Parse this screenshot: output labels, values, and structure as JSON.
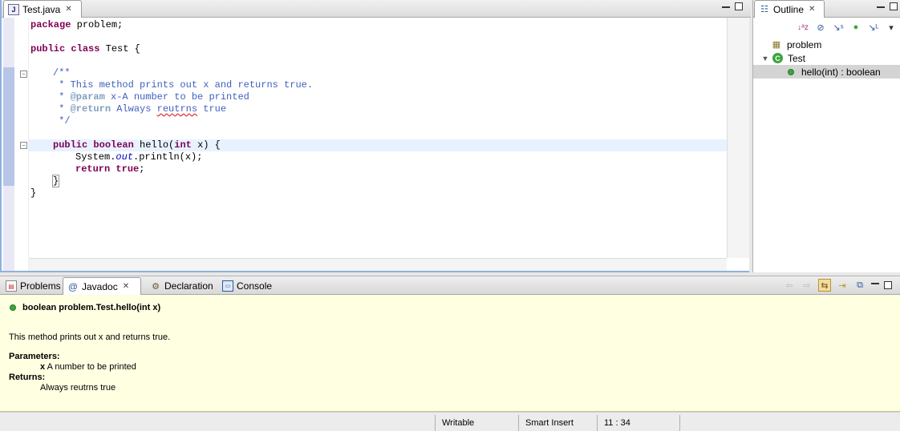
{
  "editor": {
    "tab_label": "Test.java",
    "code_lines": [
      [
        "package problem;"
      ],
      [],
      [
        "public class Test {"
      ],
      [],
      [
        "/**"
      ],
      [
        " * This method prints out x and returns true."
      ],
      [
        " * @param x-A number to be printed"
      ],
      [
        " * @return Always reutrns true"
      ],
      [
        " */"
      ],
      [],
      [
        "public boolean hello(int x) {"
      ],
      [
        "System.out.println(x);"
      ],
      [
        "return true;"
      ],
      [
        "}"
      ],
      [
        "}"
      ]
    ],
    "segments": {
      "l1_kw": "package",
      "l1_rest": " problem;",
      "l3_kw1": "public",
      "l3_kw2": "class",
      "l3_rest": " Test {",
      "l5": "/**",
      "l6": " * This method prints out x and returns true.",
      "l7_pre": " * ",
      "l7_tag": "@param",
      "l7_rest": " x-A number to be printed",
      "l8_pre": " * ",
      "l8_tag": "@return",
      "l8_mid": " Always ",
      "l8_spell": "reutrns",
      "l8_rest": " true",
      "l9": " */",
      "l11_kw1": "public",
      "l11_kw2": "boolean",
      "l11_mid": " hello(",
      "l11_kw3": "int",
      "l11_rest": " x) {",
      "l12_pre": "System.",
      "l12_it": "out",
      "l12_rest": ".println(x);",
      "l13_kw": "return",
      "l13_kw2": "true",
      "l13_rest": ";",
      "l14": "}",
      "l15": "}"
    }
  },
  "outline": {
    "tab_label": "Outline",
    "toolbar_icons": [
      "sort-alpha-icon",
      "hide-fields-icon",
      "hide-static-icon",
      "hide-nonpublic-icon",
      "hide-local-types-icon",
      "view-menu-icon"
    ],
    "tree": [
      {
        "label": "problem",
        "icon": "package-icon"
      },
      {
        "label": "Test",
        "icon": "class-icon"
      },
      {
        "label": "hello(int) : boolean",
        "icon": "public-method-icon"
      }
    ]
  },
  "bottom": {
    "tabs": [
      {
        "label": "Problems",
        "icon": "problems-icon"
      },
      {
        "label": "Javadoc",
        "icon": "javadoc-icon"
      },
      {
        "label": "Declaration",
        "icon": "declaration-icon"
      },
      {
        "label": "Console",
        "icon": "console-icon"
      }
    ]
  },
  "javadoc": {
    "signature": "boolean  problem.Test.hello(int x)",
    "description": "This method prints out x and returns true.",
    "params_heading": "Parameters:",
    "param_name": "x",
    "param_desc": " A number to be printed",
    "returns_heading": "Returns:",
    "returns_desc": "Always reutrns true"
  },
  "status": {
    "writable": "Writable",
    "insert_mode": "Smart Insert",
    "position": "11 : 34"
  },
  "colors": {
    "keyword": "#7f0055",
    "comment": "#3f5fbf",
    "javadoc_tag": "#7f9fbf",
    "javadoc_bg": "#ffffe1",
    "current_line": "#e8f2fe"
  }
}
